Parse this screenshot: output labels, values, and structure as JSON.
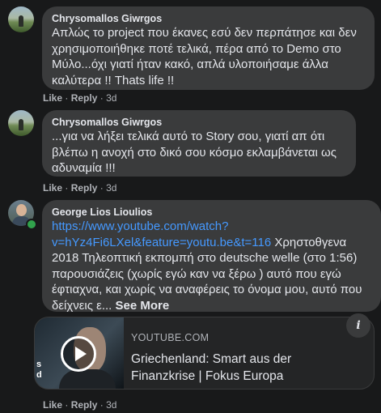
{
  "comments": [
    {
      "author": "Chrysomallos Giwrgos",
      "text": "Απλώς το project που έκανες εσύ δεν περπάτησε και δεν χρησιμοποιήθηκε ποτέ τελικά, πέρα από το Demo στο Μύλο...όχι γιατί ήταν κακό, απλά υλοποιήσαμε άλλα καλύτερα !! Thats life !!",
      "like": "Like",
      "reply": "Reply",
      "separator": "·",
      "time": "3d"
    },
    {
      "author": "Chrysomallos Giwrgos",
      "text": "...για να λήξει τελικά αυτό το Story σου, γιατί απ ότι βλέπω η ανοχή στο δικό σου κόσμο εκλαμβάνεται ως αδυναμία !!!",
      "like": "Like",
      "reply": "Reply",
      "separator": "·",
      "time": "3d"
    },
    {
      "author": "George Lios Lioulios",
      "link": "https://www.youtube.com/watch?v=hYz4Fi6LXel&feature=youtu.be&t=116",
      "text": " Χρηστοθγενα 2018 Τηλεοπτική εκπομπή στο deutsche welle (στο 1:56) παρουσιάζεις (χωρίς εγώ καν να ξέρω ) αυτό που εγώ έφτιαχνα, και χωρίς να αναφέρεις το όνομα μου, αυτό που δείχνεις ε... ",
      "see_more": "See More",
      "like": "Like",
      "reply": "Reply",
      "separator": "·",
      "time": "3d"
    }
  ],
  "link_preview": {
    "site": "YOUTUBE.COM",
    "title": "Griechenland: Smart aus der Finanzkrise | Fokus Europa",
    "thumb_caption": "s\nd",
    "info_icon": "i"
  },
  "icons": {
    "play": "play-icon",
    "info": "info-icon"
  },
  "colors": {
    "background": "#18191a",
    "bubble": "#3a3b3c",
    "link": "#4599ff",
    "online": "#31a24c"
  }
}
